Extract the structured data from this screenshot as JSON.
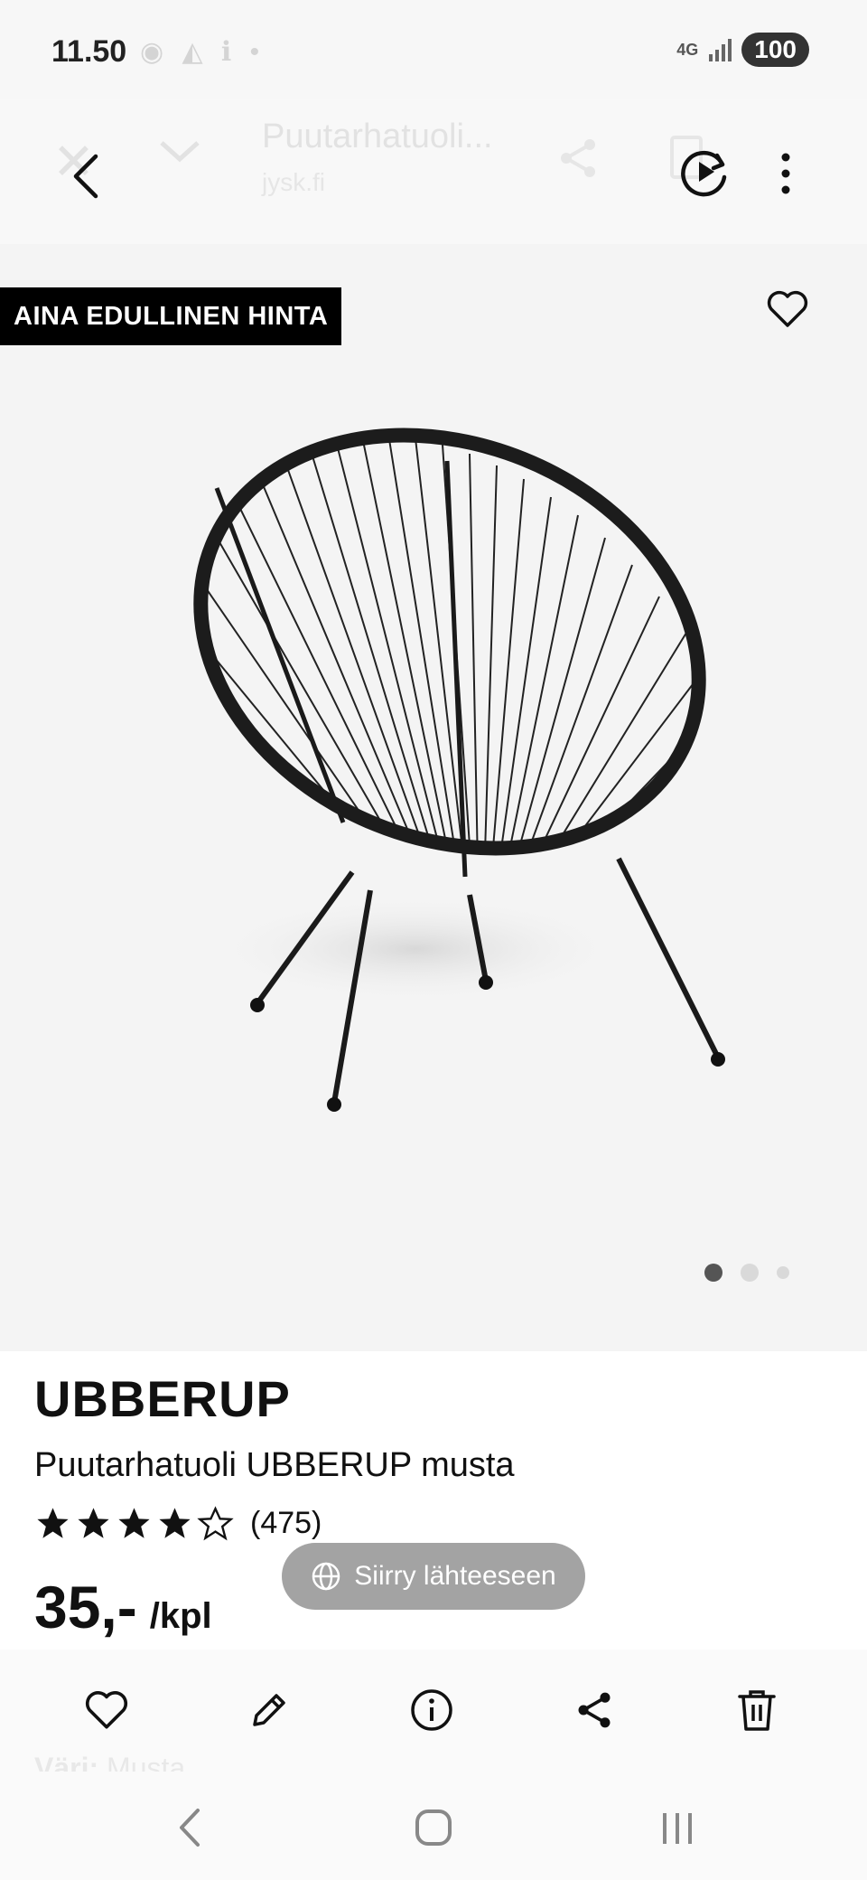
{
  "status_bar": {
    "time": "11.50",
    "network": "4G",
    "battery": "100"
  },
  "browser": {
    "faded_title": "Puutarhatuoli...",
    "faded_url": "jysk.fi"
  },
  "product_image": {
    "badge": "AINA EDULLINEN HINTA",
    "image_count": 3,
    "active_image": 1
  },
  "product": {
    "brand": "UBBERUP",
    "title": "Puutarhatuoli UBBERUP musta",
    "rating": 4,
    "rating_max": 5,
    "rating_count": "(475)",
    "price": "35,-",
    "unit": "/kpl",
    "faded_color_label": "Väri:",
    "faded_color_value": "Musta"
  },
  "source_pill": {
    "label": "Siirry lähteeseen"
  },
  "colors": {
    "badge_bg": "#000000",
    "image_bg": "#f4f4f4",
    "pill_bg": "#a3a3a3"
  }
}
